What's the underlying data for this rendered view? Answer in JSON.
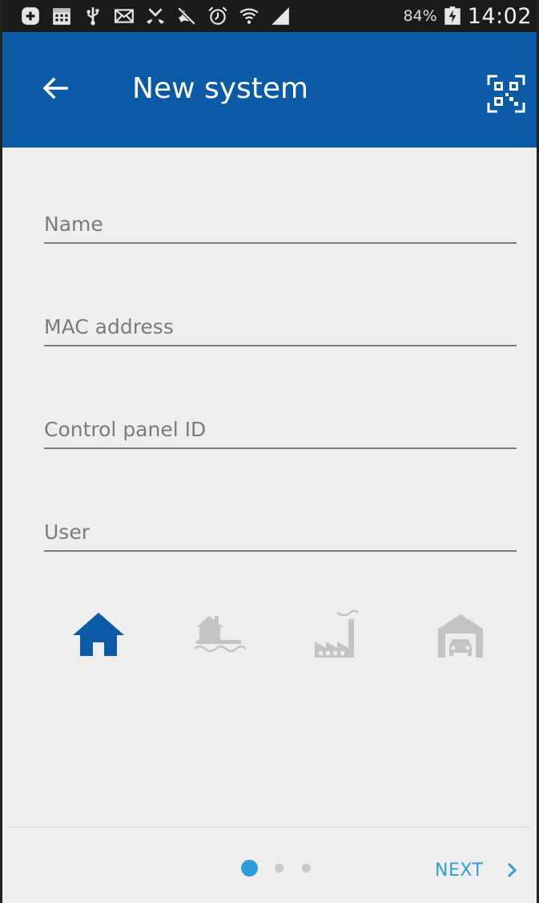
{
  "status_bar": {
    "battery_percent": "84%",
    "time": "14:02",
    "icons": [
      "plus-box-icon",
      "calendar-icon",
      "usb-icon",
      "email-icon",
      "missed-call-icon",
      "mute-icon",
      "alarm-icon",
      "wifi-icon",
      "signal-icon",
      "battery-charging-icon"
    ]
  },
  "app_bar": {
    "title": "New system",
    "back_icon": "arrow-left-icon",
    "qr_icon": "qr-code-scan-icon",
    "color": "#0a5aa6"
  },
  "form": {
    "name": {
      "placeholder": "Name",
      "value": ""
    },
    "mac": {
      "placeholder": "MAC address",
      "value": ""
    },
    "panel_id": {
      "placeholder": "Control panel ID",
      "value": ""
    },
    "user": {
      "placeholder": "User",
      "value": ""
    }
  },
  "system_types": {
    "selected": "home",
    "items": [
      "home-icon",
      "lake-house-icon",
      "factory-icon",
      "garage-icon"
    ],
    "active_color": "#0a5aa6",
    "inactive_color": "#c4c4c4"
  },
  "footer": {
    "next_label": "NEXT",
    "page_count": 3,
    "current_page": 1,
    "accent_color": "#2f9ed8"
  }
}
